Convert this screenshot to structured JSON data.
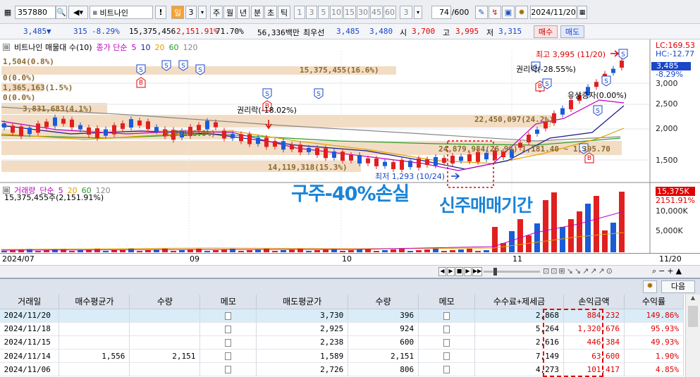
{
  "toolbar": {
    "code": "357880",
    "stock_name": "비트나인",
    "exclaim": "!",
    "period_day": "일",
    "period_num": "3",
    "periods": [
      "주",
      "월",
      "년",
      "분",
      "초",
      "틱"
    ],
    "minutes": [
      "1",
      "3",
      "5",
      "10",
      "15",
      "30",
      "45",
      "60"
    ],
    "custom_min": "3",
    "count": "74",
    "count_total": "/600",
    "date": "2024/11/20"
  },
  "quote": {
    "price": "3,485",
    "change": "315",
    "change_pct": "-8.29%",
    "volume": "15,375,456",
    "volume_pct": "2,151.91%",
    "turnover": "71.70%",
    "amount": "56,336백만",
    "best_label": "최우선",
    "ask": "3,485",
    "bid": "3,480",
    "open_label": "시",
    "open": "3,700",
    "high_label": "고",
    "high": "3,995",
    "low_label": "저",
    "low": "3,315",
    "buy_button": "매수",
    "sell_button": "매도"
  },
  "chart": {
    "legend_name": "비트나인 매물대 수(10)",
    "legend_ma": "종가 단순",
    "ma": [
      "5",
      "10",
      "20",
      "60",
      "120"
    ],
    "ma_colors": [
      "#c000c0",
      "#1a1a8c",
      "#e0a000",
      "#2a9a2a",
      "#888888"
    ],
    "volume_label": "거래량",
    "volume_ma": "단순",
    "volume_ma_list": [
      "5",
      "20",
      "60",
      "120"
    ],
    "volume_info": "15,375,455주(2,151.91%)",
    "lc": "LC:169.53",
    "hc": "HC:-12.77",
    "price_tag": "3,485",
    "price_tag_pct": "-8.29%",
    "volume_tag": "15,375K",
    "volume_tag_pct": "2151.91%",
    "y_ticks": [
      "3,000",
      "2,500",
      "2,000",
      "1,500"
    ],
    "vol_ticks": [
      "10,000K",
      "5,000K"
    ],
    "annotations": {
      "high": "최고 3,995 (11/20)",
      "low": "최저 1,293 (10/24)",
      "rights1": "권리락(-18.02%)",
      "rights2": "권리락(-28.55%)",
      "capital": "유상증자(0.00%)",
      "p1": "1,504(0.8%)",
      "p2": "0(0.0%)",
      "p3": "1,365,163(1.5%)",
      "p4": "0(0.0%)",
      "p5": "3,831,683(4.1%)",
      "p6": "15,375,455(16.6%)",
      "p7": "22,450,097(24.2%)",
      "p8": "24,879,984(26.9%)",
      "p9": "1,181.40 ~ 1,395.70",
      "p10": "14,119,318(15.3%)",
      "p11": "5,591(6.0%)"
    },
    "dates": [
      "2024/07",
      "09",
      "10",
      "11",
      "11/20"
    ],
    "overlay_old": "구주-40%손실",
    "overlay_new": "신주매매기간"
  },
  "grid": {
    "next_button": "다음",
    "headers": [
      "거래일",
      "매수평균가",
      "수량",
      "메모",
      "매도평균가",
      "수량",
      "메모",
      "수수료+제세금",
      "손익금액",
      "수익률"
    ],
    "rows": [
      [
        "2024/11/20",
        "",
        "",
        "",
        "3,730",
        "396",
        "",
        "2,868",
        "884,232",
        "149.86%"
      ],
      [
        "2024/11/18",
        "",
        "",
        "",
        "2,925",
        "924",
        "",
        "5,264",
        "1,320,676",
        "95.93%"
      ],
      [
        "2024/11/15",
        "",
        "",
        "",
        "2,238",
        "600",
        "",
        "2,616",
        "446,384",
        "49.93%"
      ],
      [
        "2024/11/14",
        "1,556",
        "2,151",
        "",
        "1,589",
        "2,151",
        "",
        "7,149",
        "63,600",
        "1.90%"
      ],
      [
        "2024/11/06",
        "",
        "",
        "",
        "2,726",
        "806",
        "",
        "4,273",
        "101,417",
        "4.85%"
      ]
    ]
  }
}
